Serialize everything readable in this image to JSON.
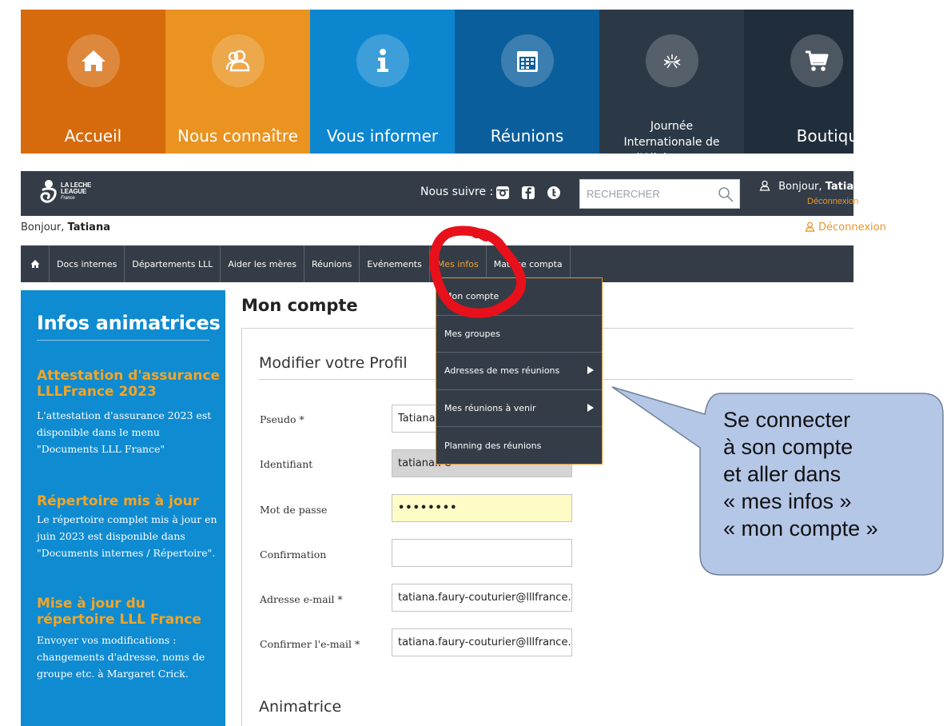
{
  "top_tiles": [
    {
      "label": "Accueil",
      "icon": "home-icon",
      "color": "#d66b0d"
    },
    {
      "label": "Nous connaître",
      "icon": "people-icon",
      "color": "#ea9320"
    },
    {
      "label": "Vous informer",
      "icon": "info-icon",
      "color": "#0d86d0"
    },
    {
      "label": "Réunions",
      "icon": "calendar-icon",
      "color": "#0a5e9c"
    },
    {
      "label": "Journée Internationale de l'Allaitement",
      "icon": "sunburst-icon",
      "color": "#2b3947"
    },
    {
      "label": "Boutique",
      "icon": "cart-icon",
      "color": "#202d3b"
    }
  ],
  "header": {
    "logo_lines": [
      "LA LECHE",
      "LEAGUE",
      "France"
    ],
    "follow_label": "Nous suivre :",
    "social_icons": [
      "instagram-icon",
      "facebook-icon",
      "twitter-icon"
    ],
    "search_placeholder": "RECHERCHER",
    "greeting": "Bonjour,",
    "user": "Tatiana",
    "logout": "Déconnexion"
  },
  "greeting_row": {
    "greeting": "Bonjour,",
    "user": "Tatiana",
    "logout": "Déconnexion"
  },
  "nav": {
    "items": [
      "Docs internes",
      "Départements LLL",
      "Aider les mères",
      "Réunions",
      "Evénements",
      "Mes infos",
      "Matrice compta"
    ],
    "active": "Mes infos"
  },
  "dropdown": {
    "items": [
      "Mon compte",
      "Mes groupes",
      "Adresses de mes réunions",
      "Mes réunions à venir",
      "Planning des réunions"
    ]
  },
  "sidebar": {
    "title": "Infos animatrices",
    "blocks": [
      {
        "title": "Attestation d'assurance LLLFrance 2023",
        "text": "L'attestation d'assurance 2023 est disponible dans le menu \"Documents LLL France\""
      },
      {
        "title": "Répertoire mis à jour",
        "text": "Le répertoire complet mis à jour en juin 2023  est disponible dans \"Documents internes / Répertoire\"."
      },
      {
        "title": "Mise à jour du répertoire LLL France",
        "text": "Envoyer vos modifications : changements d'adresse, noms de groupe etc. à  Margaret Crick."
      }
    ]
  },
  "main": {
    "title": "Mon compte",
    "section_title": "Modifier votre Profil",
    "fields": [
      {
        "label": "Pseudo *",
        "value": "Tatiana"
      },
      {
        "label": "Identifiant",
        "value": "tatiana.FC"
      },
      {
        "label": "Mot de passe",
        "value": "••••••••"
      },
      {
        "label": "Confirmation",
        "value": ""
      },
      {
        "label": "Adresse e-mail *",
        "value": "tatiana.faury-couturier@lllfrance.org"
      },
      {
        "label": "Confirmer l'e-mail *",
        "value": "tatiana.faury-couturier@lllfrance.org"
      }
    ],
    "section2_title": "Animatrice"
  },
  "annotation": {
    "lines": [
      "Se connecter",
      "à son compte",
      "et aller dans",
      "« mes infos »",
      "« mon compte »"
    ],
    "bubble_color": "#b4c7e7",
    "marker_color": "#e8101a"
  }
}
